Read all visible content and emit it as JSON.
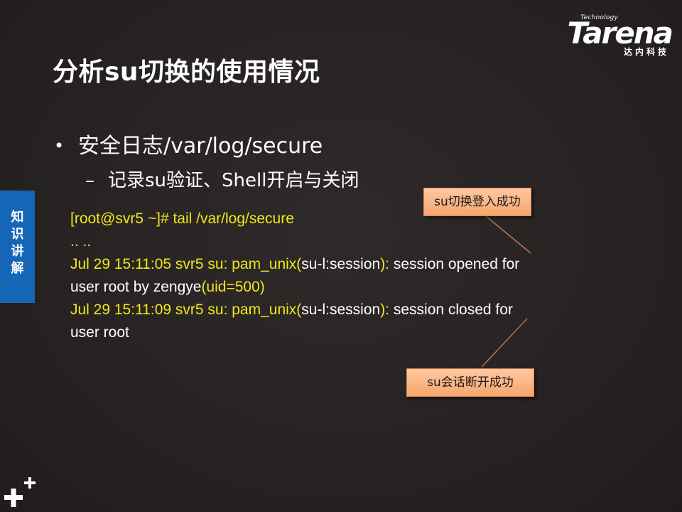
{
  "logo": {
    "technology": "Technology",
    "brand": "Tarena",
    "chinese": "达内科技"
  },
  "title": "分析su切换的使用情况",
  "bullets": {
    "level1": "安全日志/var/log/secure",
    "level1_marker": "•",
    "level2": "记录su验证、Shell开启与关闭",
    "level2_marker": "–"
  },
  "side_tab": {
    "label": "知识讲解"
  },
  "log": {
    "command": "[root@svr5 ~]# tail  /var/log/secure",
    "ellipsis": ".. ..",
    "line1": {
      "prefix": "Jul 29 15:11:05 svr5 su: pam_unix(",
      "session": "su-l:session",
      "close_paren": "):",
      "rest": " session opened for"
    },
    "line1_cont": {
      "text": "user root by zengye",
      "uid": "(uid=500)"
    },
    "line2": {
      "prefix": "Jul 29 15:11:09 svr5 su: pam_unix(",
      "session": "su-l:session",
      "close_paren": "):",
      "rest": " session closed for"
    },
    "line2_cont": {
      "text": "user root"
    }
  },
  "callouts": {
    "login_success": "su切换登入成功",
    "session_disconnect": "su会话断开成功"
  },
  "colors": {
    "background": "#2b2626",
    "log_highlight": "#f0e619",
    "side_tab": "#1666b8",
    "callout_fill": "#f7a56c"
  }
}
